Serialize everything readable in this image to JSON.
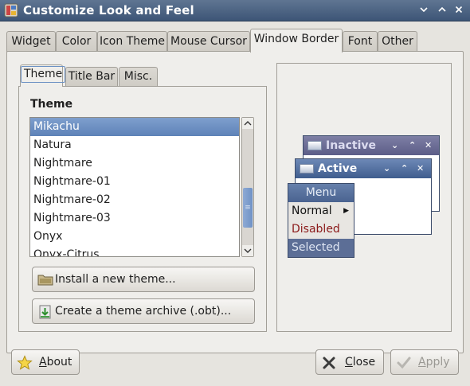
{
  "window": {
    "title": "Customize Look and Feel",
    "buttons": [
      "chevron-down",
      "chevron-up",
      "close"
    ]
  },
  "tabs": [
    {
      "label": "Widget",
      "active": false
    },
    {
      "label": "Color",
      "active": false
    },
    {
      "label": "Icon Theme",
      "active": false
    },
    {
      "label": "Mouse Cursor",
      "active": false
    },
    {
      "label": "Window Border",
      "active": true
    },
    {
      "label": "Font",
      "active": false
    },
    {
      "label": "Other",
      "active": false
    }
  ],
  "subtabs": [
    {
      "label": "Theme",
      "active": true
    },
    {
      "label": "Title Bar",
      "active": false
    },
    {
      "label": "Misc.",
      "active": false
    }
  ],
  "theme_section": {
    "heading": "Theme",
    "items": [
      "Mikachu",
      "Natura",
      "Nightmare",
      "Nightmare-01",
      "Nightmare-02",
      "Nightmare-03",
      "Onyx",
      "Onyx-Citrus"
    ],
    "selected_index": 0,
    "install_button": "Install a new theme...",
    "archive_button": "Create a theme archive (.obt)..."
  },
  "preview": {
    "inactive_title": "Inactive",
    "active_title": "Active",
    "menu": {
      "header": "Menu",
      "items": [
        {
          "label": "Normal",
          "state": "normal"
        },
        {
          "label": "Disabled",
          "state": "disabled"
        },
        {
          "label": "Selected",
          "state": "selected"
        }
      ]
    }
  },
  "footer": {
    "about": "About",
    "close": "Close",
    "apply": "Apply"
  },
  "colors": {
    "titlebar": "#3d5576",
    "selection": "#5e82b8",
    "disabled_text": "#8b1a1a"
  }
}
